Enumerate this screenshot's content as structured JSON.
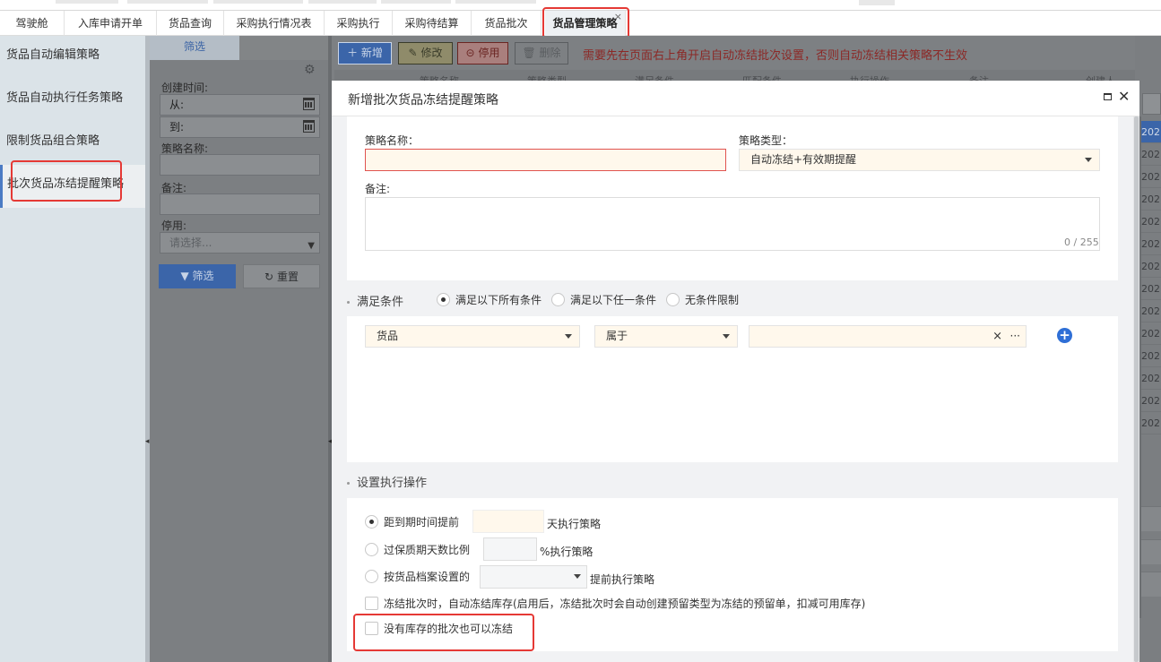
{
  "tabs": [
    {
      "label": "驾驶舱"
    },
    {
      "label": "入库申请开单"
    },
    {
      "label": "货品查询"
    },
    {
      "label": "采购执行情况表"
    },
    {
      "label": "采购执行"
    },
    {
      "label": "采购待结算"
    },
    {
      "label": "货品批次"
    },
    {
      "label": "货品管理策略",
      "active": true,
      "close": "×"
    }
  ],
  "sidebar": {
    "items": [
      {
        "label": "货品自动编辑策略"
      },
      {
        "label": "货品自动执行任务策略"
      },
      {
        "label": "限制货品组合策略"
      },
      {
        "label": "批次货品冻结提醒策略",
        "active": true
      }
    ]
  },
  "filter": {
    "tab_label": "筛选",
    "created_time_label": "创建时间:",
    "from_label": "从:",
    "to_label": "到:",
    "strategy_name_label": "策略名称:",
    "remark_label": "备注:",
    "disabled_label": "停用:",
    "disabled_placeholder": "请选择...",
    "filter_button": "筛选",
    "reset_button": "重置"
  },
  "toolbar": {
    "add": "新增",
    "edit": "修改",
    "disable": "停用",
    "delete": "删除",
    "notice": "需要先在页面右上角开启自动冻结批次设置，否则自动冻结相关策略不生效"
  },
  "grid": {
    "headers": [
      "策略名称",
      "策略类型",
      "满足条件",
      "匹配条件",
      "执行操作",
      "备注",
      "创建人"
    ],
    "right_cells": [
      "202",
      "202",
      "202",
      "202",
      "202",
      "202",
      "202",
      "202",
      "202",
      "202",
      "202",
      "202",
      "202",
      "202"
    ]
  },
  "dialog": {
    "title": "新增批次货品冻结提醒策略",
    "strategy_name_label": "策略名称：",
    "strategy_name_value": "",
    "strategy_type_label": "策略类型：",
    "strategy_type_value": "自动冻结+有效期提醒",
    "remark_label": "备注:",
    "remark_counter": "0 / 255",
    "condition_section": "满足条件",
    "condition_options": [
      {
        "label": "满足以下所有条件",
        "checked": true
      },
      {
        "label": "满足以下任一条件",
        "checked": false
      },
      {
        "label": "无条件限制",
        "checked": false
      }
    ],
    "condition_row": {
      "field": "货品",
      "operator": "属于",
      "value": "",
      "clear": "×",
      "more": "···"
    },
    "action_section": "设置执行操作",
    "action_options": [
      {
        "label": "距到期时间提前",
        "suffix": "天执行策略",
        "checked": true,
        "value": ""
      },
      {
        "label": "过保质期天数比例",
        "suffix": "%执行策略",
        "checked": false,
        "value": ""
      },
      {
        "label": "按货品档案设置的",
        "suffix": "提前执行策略",
        "checked": false,
        "value": ""
      }
    ],
    "checkboxes": [
      {
        "label": "冻结批次时，自动冻结库存(启用后，冻结批次时会自动创建预留类型为冻结的预留单，扣减可用库存)",
        "checked": false
      },
      {
        "label": "没有库存的批次也可以冻结",
        "checked": false
      }
    ]
  },
  "colors": {
    "primary": "#3b65a9",
    "notice_red": "#e53935",
    "highlight_box": "#e53935",
    "required_field_bg": "#fff8ec"
  }
}
